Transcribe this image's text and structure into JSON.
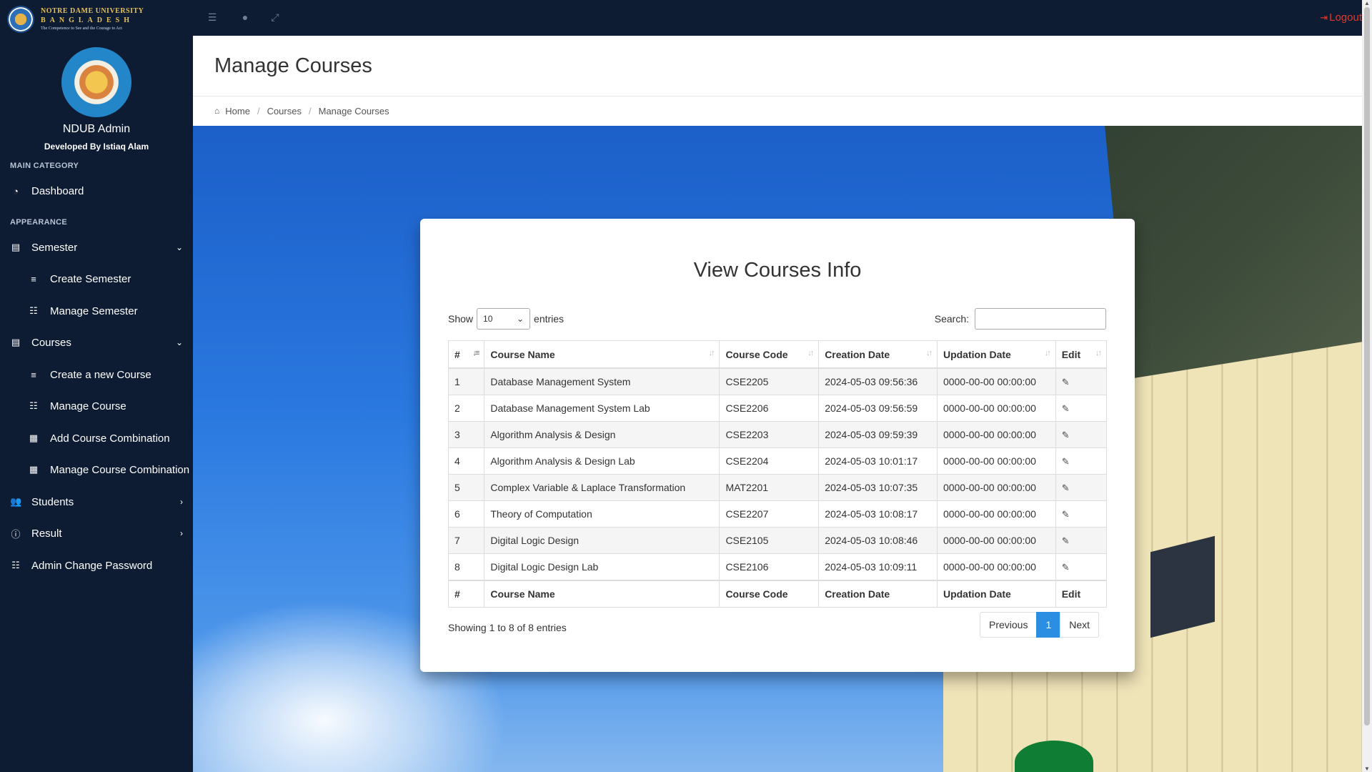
{
  "brand": {
    "line1": "NOTRE DAME UNIVERSITY",
    "line2": "BANGLADESH",
    "line3": "The Competence to See and the Courage to Act"
  },
  "topbar": {
    "logout_label": "Logout",
    "icons": [
      "menu-icon",
      "user-icon",
      "expand-icon"
    ]
  },
  "sidebar": {
    "profile_name": "NDUB Admin",
    "developer": "Developed By Istiaq Alam",
    "main_category_label": "MAIN CATEGORY",
    "appearance_label": "APPEARANCE",
    "items": {
      "dashboard": "Dashboard",
      "semester": "Semester",
      "create_semester": "Create Semester",
      "manage_semester": "Manage Semester",
      "courses": "Courses",
      "create_course": "Create a new Course",
      "manage_course": "Manage Course",
      "add_combination": "Add Course Combination",
      "manage_combination": "Manage Course Combination",
      "students": "Students",
      "result": "Result",
      "admin_password": "Admin Change Password"
    }
  },
  "header": {
    "title": "Manage Courses"
  },
  "breadcrumb": {
    "home": "Home",
    "courses": "Courses",
    "current": "Manage Courses"
  },
  "card": {
    "title": "View Courses Info",
    "show_label": "Show",
    "entries_label": "entries",
    "page_length": "10",
    "search_label": "Search:",
    "search_value": "",
    "columns": [
      "#",
      "Course Name",
      "Course Code",
      "Creation Date",
      "Updation Date",
      "Edit"
    ],
    "rows": [
      {
        "num": "1",
        "name": "Database Management System",
        "code": "CSE2205",
        "created": "2024-05-03 09:56:36",
        "updated": "0000-00-00 00:00:00"
      },
      {
        "num": "2",
        "name": "Database Management System Lab",
        "code": "CSE2206",
        "created": "2024-05-03 09:56:59",
        "updated": "0000-00-00 00:00:00"
      },
      {
        "num": "3",
        "name": "Algorithm Analysis & Design",
        "code": "CSE2203",
        "created": "2024-05-03 09:59:39",
        "updated": "0000-00-00 00:00:00"
      },
      {
        "num": "4",
        "name": "Algorithm Analysis & Design Lab",
        "code": "CSE2204",
        "created": "2024-05-03 10:01:17",
        "updated": "0000-00-00 00:00:00"
      },
      {
        "num": "5",
        "name": "Complex Variable & Laplace Transformation",
        "code": "MAT2201",
        "created": "2024-05-03 10:07:35",
        "updated": "0000-00-00 00:00:00"
      },
      {
        "num": "6",
        "name": "Theory of Computation",
        "code": "CSE2207",
        "created": "2024-05-03 10:08:17",
        "updated": "0000-00-00 00:00:00"
      },
      {
        "num": "7",
        "name": "Digital Logic Design",
        "code": "CSE2105",
        "created": "2024-05-03 10:08:46",
        "updated": "0000-00-00 00:00:00"
      },
      {
        "num": "8",
        "name": "Digital Logic Design Lab",
        "code": "CSE2106",
        "created": "2024-05-03 10:09:11",
        "updated": "0000-00-00 00:00:00"
      }
    ],
    "info": "Showing 1 to 8 of 8 entries",
    "pager": {
      "previous": "Previous",
      "current": "1",
      "next": "Next"
    }
  },
  "colors": {
    "sidebar_bg": "#0d1b33",
    "logout": "#e0392b",
    "page_active": "#2c8ee0"
  }
}
